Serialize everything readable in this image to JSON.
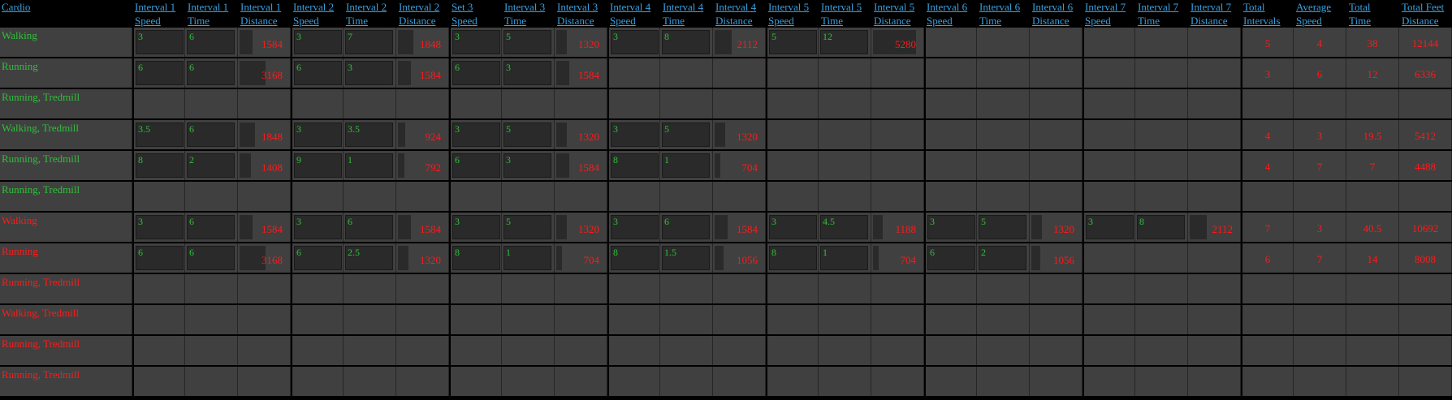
{
  "headers": [
    {
      "l1": "Cardio",
      "l2": ""
    },
    {
      "l1": "Interval 1",
      "l2": "Speed"
    },
    {
      "l1": "Interval 1",
      "l2": "Time"
    },
    {
      "l1": "Interval 1",
      "l2": "Distance"
    },
    {
      "l1": "Interval 2",
      "l2": "Speed"
    },
    {
      "l1": "Interval 2",
      "l2": "Time"
    },
    {
      "l1": "Interval 2",
      "l2": "Distance"
    },
    {
      "l1": "Set 3",
      "l2": "Speed"
    },
    {
      "l1": "Interval 3",
      "l2": "Time"
    },
    {
      "l1": "Interval 3",
      "l2": "Distance"
    },
    {
      "l1": "Interval 4",
      "l2": "Speed"
    },
    {
      "l1": "Interval 4",
      "l2": "Time"
    },
    {
      "l1": "Interval 4",
      "l2": "Distance"
    },
    {
      "l1": "Interval 5",
      "l2": "Speed"
    },
    {
      "l1": "Interval 5",
      "l2": "Time"
    },
    {
      "l1": "Interval 5",
      "l2": "Distance"
    },
    {
      "l1": "Interval 6",
      "l2": "Speed"
    },
    {
      "l1": "Interval 6",
      "l2": "Time"
    },
    {
      "l1": "Interval 6",
      "l2": "Distance"
    },
    {
      "l1": "Interval 7",
      "l2": "Speed"
    },
    {
      "l1": "Interval 7",
      "l2": "Time"
    },
    {
      "l1": "Interval 7",
      "l2": "Distance"
    },
    {
      "l1": "Total",
      "l2": "Intervals"
    },
    {
      "l1": "Average",
      "l2": "Speed"
    },
    {
      "l1": "Total",
      "l2": "Time"
    },
    {
      "l1": "Total Feet",
      "l2": "Distance"
    }
  ],
  "rows": [
    {
      "label": "Walking",
      "color": "green",
      "intervals": [
        [
          "3",
          "6",
          "1584"
        ],
        [
          "3",
          "7",
          "1848"
        ],
        [
          "3",
          "5",
          "1320"
        ],
        [
          "3",
          "8",
          "2112"
        ],
        [
          "5",
          "12",
          "5280"
        ],
        null,
        null
      ],
      "totals": [
        "5",
        "4",
        "38",
        "12144"
      ]
    },
    {
      "label": "Running",
      "color": "green",
      "intervals": [
        [
          "6",
          "6",
          "3168"
        ],
        [
          "6",
          "3",
          "1584"
        ],
        [
          "6",
          "3",
          "1584"
        ],
        null,
        null,
        null,
        null
      ],
      "totals": [
        "3",
        "6",
        "12",
        "6336"
      ]
    },
    {
      "label": "Running, Tredmill",
      "color": "green",
      "intervals": [
        null,
        null,
        null,
        null,
        null,
        null,
        null
      ],
      "totals": null
    },
    {
      "label": "Walking, Tredmill",
      "color": "green",
      "intervals": [
        [
          "3.5",
          "6",
          "1848"
        ],
        [
          "3",
          "3.5",
          "924"
        ],
        [
          "3",
          "5",
          "1320"
        ],
        [
          "3",
          "5",
          "1320"
        ],
        null,
        null,
        null
      ],
      "totals": [
        "4",
        "3",
        "19.5",
        "5412"
      ]
    },
    {
      "label": "Running, Tredmill",
      "color": "green",
      "intervals": [
        [
          "8",
          "2",
          "1408"
        ],
        [
          "9",
          "1",
          "792"
        ],
        [
          "6",
          "3",
          "1584"
        ],
        [
          "8",
          "1",
          "704"
        ],
        null,
        null,
        null
      ],
      "totals": [
        "4",
        "7",
        "7",
        "4488"
      ]
    },
    {
      "label": "Running, Tredmill",
      "color": "green",
      "intervals": [
        null,
        null,
        null,
        null,
        null,
        null,
        null
      ],
      "totals": null
    },
    {
      "label": "Walking",
      "color": "red",
      "intervals": [
        [
          "3",
          "6",
          "1584"
        ],
        [
          "3",
          "6",
          "1584"
        ],
        [
          "3",
          "5",
          "1320"
        ],
        [
          "3",
          "6",
          "1584"
        ],
        [
          "3",
          "4.5",
          "1188"
        ],
        [
          "3",
          "5",
          "1320"
        ],
        [
          "3",
          "8",
          "2112"
        ]
      ],
      "totals": [
        "7",
        "3",
        "40.5",
        "10692"
      ]
    },
    {
      "label": "Running",
      "color": "red",
      "intervals": [
        [
          "6",
          "6",
          "3168"
        ],
        [
          "6",
          "2.5",
          "1320"
        ],
        [
          "8",
          "1",
          "704"
        ],
        [
          "8",
          "1.5",
          "1056"
        ],
        [
          "8",
          "1",
          "704"
        ],
        [
          "6",
          "2",
          "1056"
        ],
        null
      ],
      "totals": [
        "6",
        "7",
        "14",
        "8008"
      ]
    },
    {
      "label": "Running, Tredmill",
      "color": "red",
      "intervals": [
        null,
        null,
        null,
        null,
        null,
        null,
        null
      ],
      "totals": null
    },
    {
      "label": "Walking, Tredmill",
      "color": "red",
      "intervals": [
        null,
        null,
        null,
        null,
        null,
        null,
        null
      ],
      "totals": null
    },
    {
      "label": "Running, Tredmill",
      "color": "red",
      "intervals": [
        null,
        null,
        null,
        null,
        null,
        null,
        null
      ],
      "totals": null
    },
    {
      "label": "Running, Tredmill",
      "color": "red",
      "intervals": [
        null,
        null,
        null,
        null,
        null,
        null,
        null
      ],
      "totals": null
    }
  ],
  "colors": {
    "header": "#3aa0e0",
    "green": "#2fbf3a",
    "red": "#ff1a1a",
    "cell": "#404040",
    "box": "#2a2a2a"
  }
}
